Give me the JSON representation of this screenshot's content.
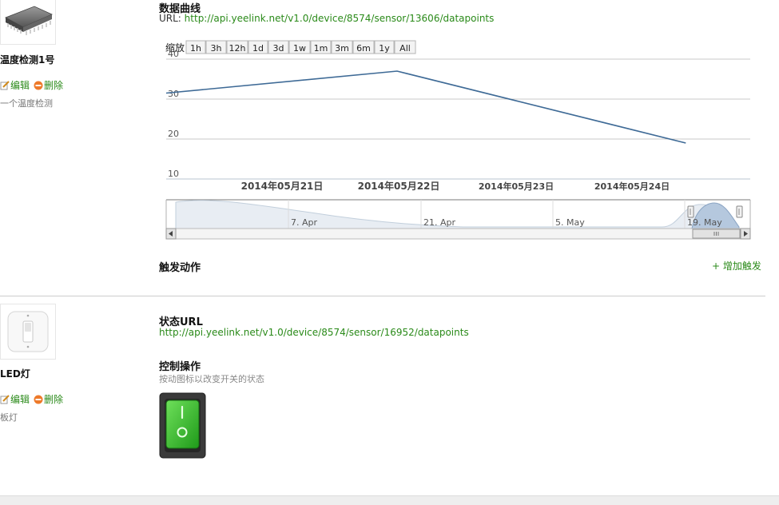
{
  "sensor": {
    "name": "温度检测1号",
    "edit_label": "编辑",
    "delete_label": "删除",
    "description": "一个温度检测",
    "chart_title": "数据曲线",
    "url_prefix": "URL: ",
    "url": "http://api.yeelink.net/v1.0/device/8574/sensor/13606/datapoints",
    "zoom_label": "缩放",
    "zoom_buttons": [
      "1h",
      "3h",
      "12h",
      "1d",
      "3d",
      "1w",
      "1m",
      "3m",
      "6m",
      "1y",
      "All"
    ],
    "y_ticks": [
      "40",
      "30",
      "20",
      "10"
    ],
    "x_ticks": [
      "2014年05月21日",
      "2014年05月22日",
      "2014年05月23日",
      "2014年05月24日"
    ],
    "navigator_ticks": [
      "7. Apr",
      "21. Apr",
      "5. May",
      "19. May"
    ],
    "trigger_title": "触发动作",
    "add_trigger_label": "+ 增加触发",
    "colors": {
      "line": "#3e6a96",
      "accent": "#2a8a19",
      "navigator_fill": "#e8edf3"
    }
  },
  "switch_device": {
    "name": "LED灯",
    "edit_label": "编辑",
    "delete_label": "删除",
    "description": "板灯",
    "status_title": "状态URL",
    "status_url": "http://api.yeelink.net/v1.0/device/8574/sensor/16952/datapoints",
    "control_title": "控制操作",
    "control_hint": "按动图标以改变开关的状态",
    "switch_state": "on"
  },
  "chart_data": {
    "type": "line",
    "title": "数据曲线",
    "x": [
      "2014-05-20",
      "2014-05-22",
      "2014-05-24T12:00"
    ],
    "series": [
      {
        "values": [
          31.5,
          37,
          19
        ]
      }
    ],
    "ylim": [
      10,
      40
    ],
    "y_ticks": [
      10,
      20,
      30,
      40
    ],
    "x_tick_labels": [
      "2014年05月21日",
      "2014年05月22日",
      "2014年05月23日",
      "2014年05月24日"
    ],
    "grid": true
  }
}
